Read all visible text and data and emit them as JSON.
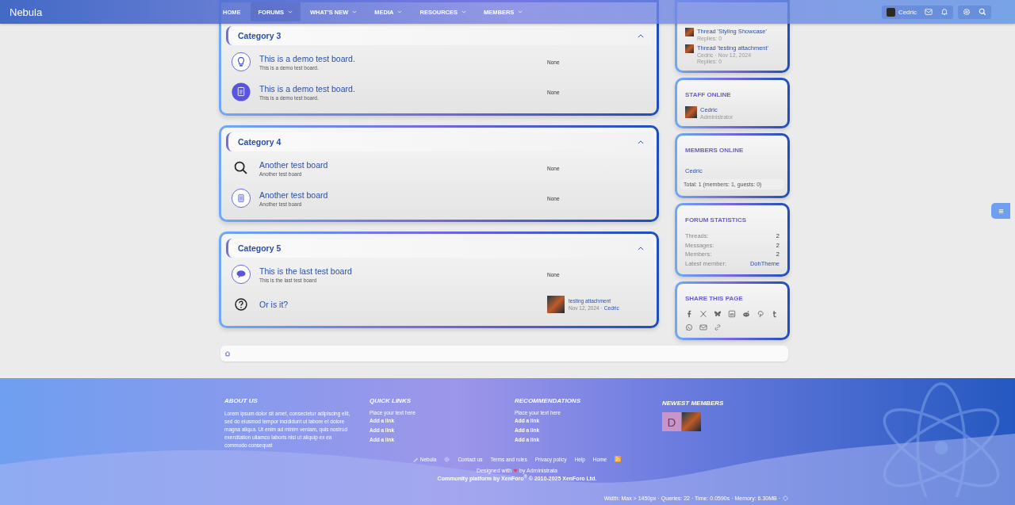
{
  "header": {
    "logo": "Nebula",
    "nav": [
      {
        "label": "HOME",
        "selected": false,
        "has_menu": false
      },
      {
        "label": "FORUMS",
        "selected": true,
        "has_menu": true
      },
      {
        "label": "WHAT'S NEW",
        "selected": false,
        "has_menu": true
      },
      {
        "label": "MEDIA",
        "selected": false,
        "has_menu": true
      },
      {
        "label": "RESOURCES",
        "selected": false,
        "has_menu": true
      },
      {
        "label": "MEMBERS",
        "selected": false,
        "has_menu": true
      }
    ],
    "user": "Cedric"
  },
  "categories": [
    {
      "title": "Category 3",
      "expanded": true,
      "boards": [
        {
          "kind": "bulb",
          "title": "This is a demo test board.",
          "description": "This is a demo test board.",
          "last_post": {
            "kind": "none",
            "text": "None"
          }
        },
        {
          "kind": "document",
          "title": "This is a demo test board.",
          "description": "This is a demo test board.",
          "last_post": {
            "kind": "none",
            "text": "None"
          }
        }
      ]
    },
    {
      "title": "Category 4",
      "expanded": true,
      "boards": [
        {
          "kind": "search",
          "title": "Another test board",
          "description": "Another test board",
          "last_post": {
            "kind": "none",
            "text": "None"
          }
        },
        {
          "kind": "sheet",
          "title": "Another test board",
          "description": "Another test board",
          "last_post": {
            "kind": "none",
            "text": "None"
          }
        }
      ]
    },
    {
      "title": "Category 5",
      "expanded": true,
      "boards": [
        {
          "kind": "chat",
          "title": "This is the last test board",
          "description": "This is the last test board",
          "last_post": {
            "kind": "none",
            "text": "None"
          }
        },
        {
          "kind": "question",
          "title": "Or is it?",
          "last_post": {
            "kind": "thread",
            "title": "testing attachment",
            "date": "Nov 12, 2024",
            "separator": "·",
            "author": "Cedric"
          }
        }
      ]
    }
  ],
  "sidebar": {
    "latest_posts": [
      {
        "title": "Thread 'Styling Showcase'",
        "replies": "Replies: 0"
      },
      {
        "title": "Thread 'testing attachment'",
        "meta": "Cedric · Nov 12, 2024",
        "replies": "Replies: 0"
      }
    ],
    "staff_online": {
      "title": "STAFF ONLINE",
      "members": [
        {
          "name": "Cedric",
          "role": "Administrator"
        }
      ]
    },
    "members_online": {
      "title": "MEMBERS ONLINE",
      "members": [
        "Cedric"
      ],
      "total": "Total: 1 (members: 1, guests: 0)"
    },
    "forum_statistics": {
      "title": "FORUM STATISTICS",
      "rows": [
        {
          "label": "Threads:",
          "value": "2",
          "kind": "number"
        },
        {
          "label": "Messages:",
          "value": "2",
          "kind": "number"
        },
        {
          "label": "Members:",
          "value": "2",
          "kind": "number"
        },
        {
          "label": "Latest member:",
          "value": "DohTheme",
          "kind": "link"
        }
      ]
    },
    "share": {
      "title": "SHARE THIS PAGE"
    }
  },
  "footer": {
    "about": {
      "title": "ABOUT US",
      "text": "Lorem ipsum dolor sit amet, consectetur adipiscing elit, sed do eiusmod tempor incididunt ut labore et dolore magna aliqua. Ut enim ad minim veniam, quis nostrud exercitation ullamco laboris nisi ut aliquip ex ea commodo consequat"
    },
    "quick_links": {
      "title": "QUICK LINKS",
      "intro": "Place your text here",
      "links": [
        "Add a link",
        "Add a link",
        "Add a link"
      ]
    },
    "recommendations": {
      "title": "RECOMMENDATIONS",
      "intro": "Place your text here",
      "links": [
        "Add a link",
        "Add a link",
        "Add a link"
      ]
    },
    "newest_members": {
      "title": "NEWEST MEMBERS",
      "members": [
        {
          "kind": "letter",
          "initial": "D",
          "color": "#c994c8"
        },
        {
          "kind": "photo"
        }
      ]
    },
    "links": [
      "Nebula",
      "Contact us",
      "Terms and rules",
      "Privacy policy",
      "Help",
      "Home"
    ],
    "credit_prefix": "Designed with",
    "credit_suffix": "by Administrata",
    "copyright": "Community platform by XenForo$^{®}$ © 2010-2025 XenForo Ltd.",
    "debug": "Width: Max > 1450px · Queries: 22 · Time: 0.0590s · Memory: 6.30MB ·"
  }
}
